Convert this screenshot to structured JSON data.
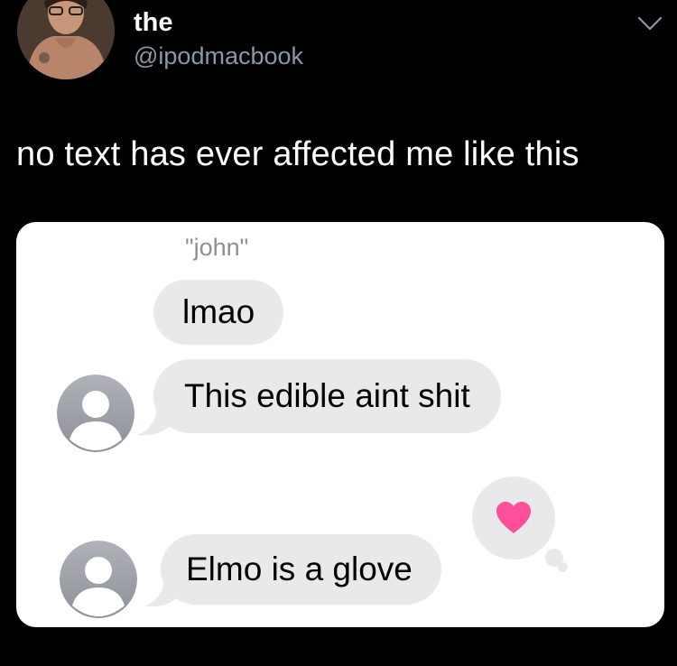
{
  "tweet": {
    "display_name": "the",
    "handle": "@ipodmacbook",
    "text": "no text has ever affected me like this",
    "menu_icon": "chevron-down-icon"
  },
  "screenshot": {
    "sender_name": "\"john\"",
    "messages": [
      {
        "text": "lmao"
      },
      {
        "text": "This edible aint shit"
      },
      {
        "text": "Elmo is a glove",
        "reaction": "heart"
      }
    ],
    "colors": {
      "bubble": "#e9e9eb",
      "heart": "#ff4f9a",
      "avatar": "#a4a6ae"
    }
  }
}
